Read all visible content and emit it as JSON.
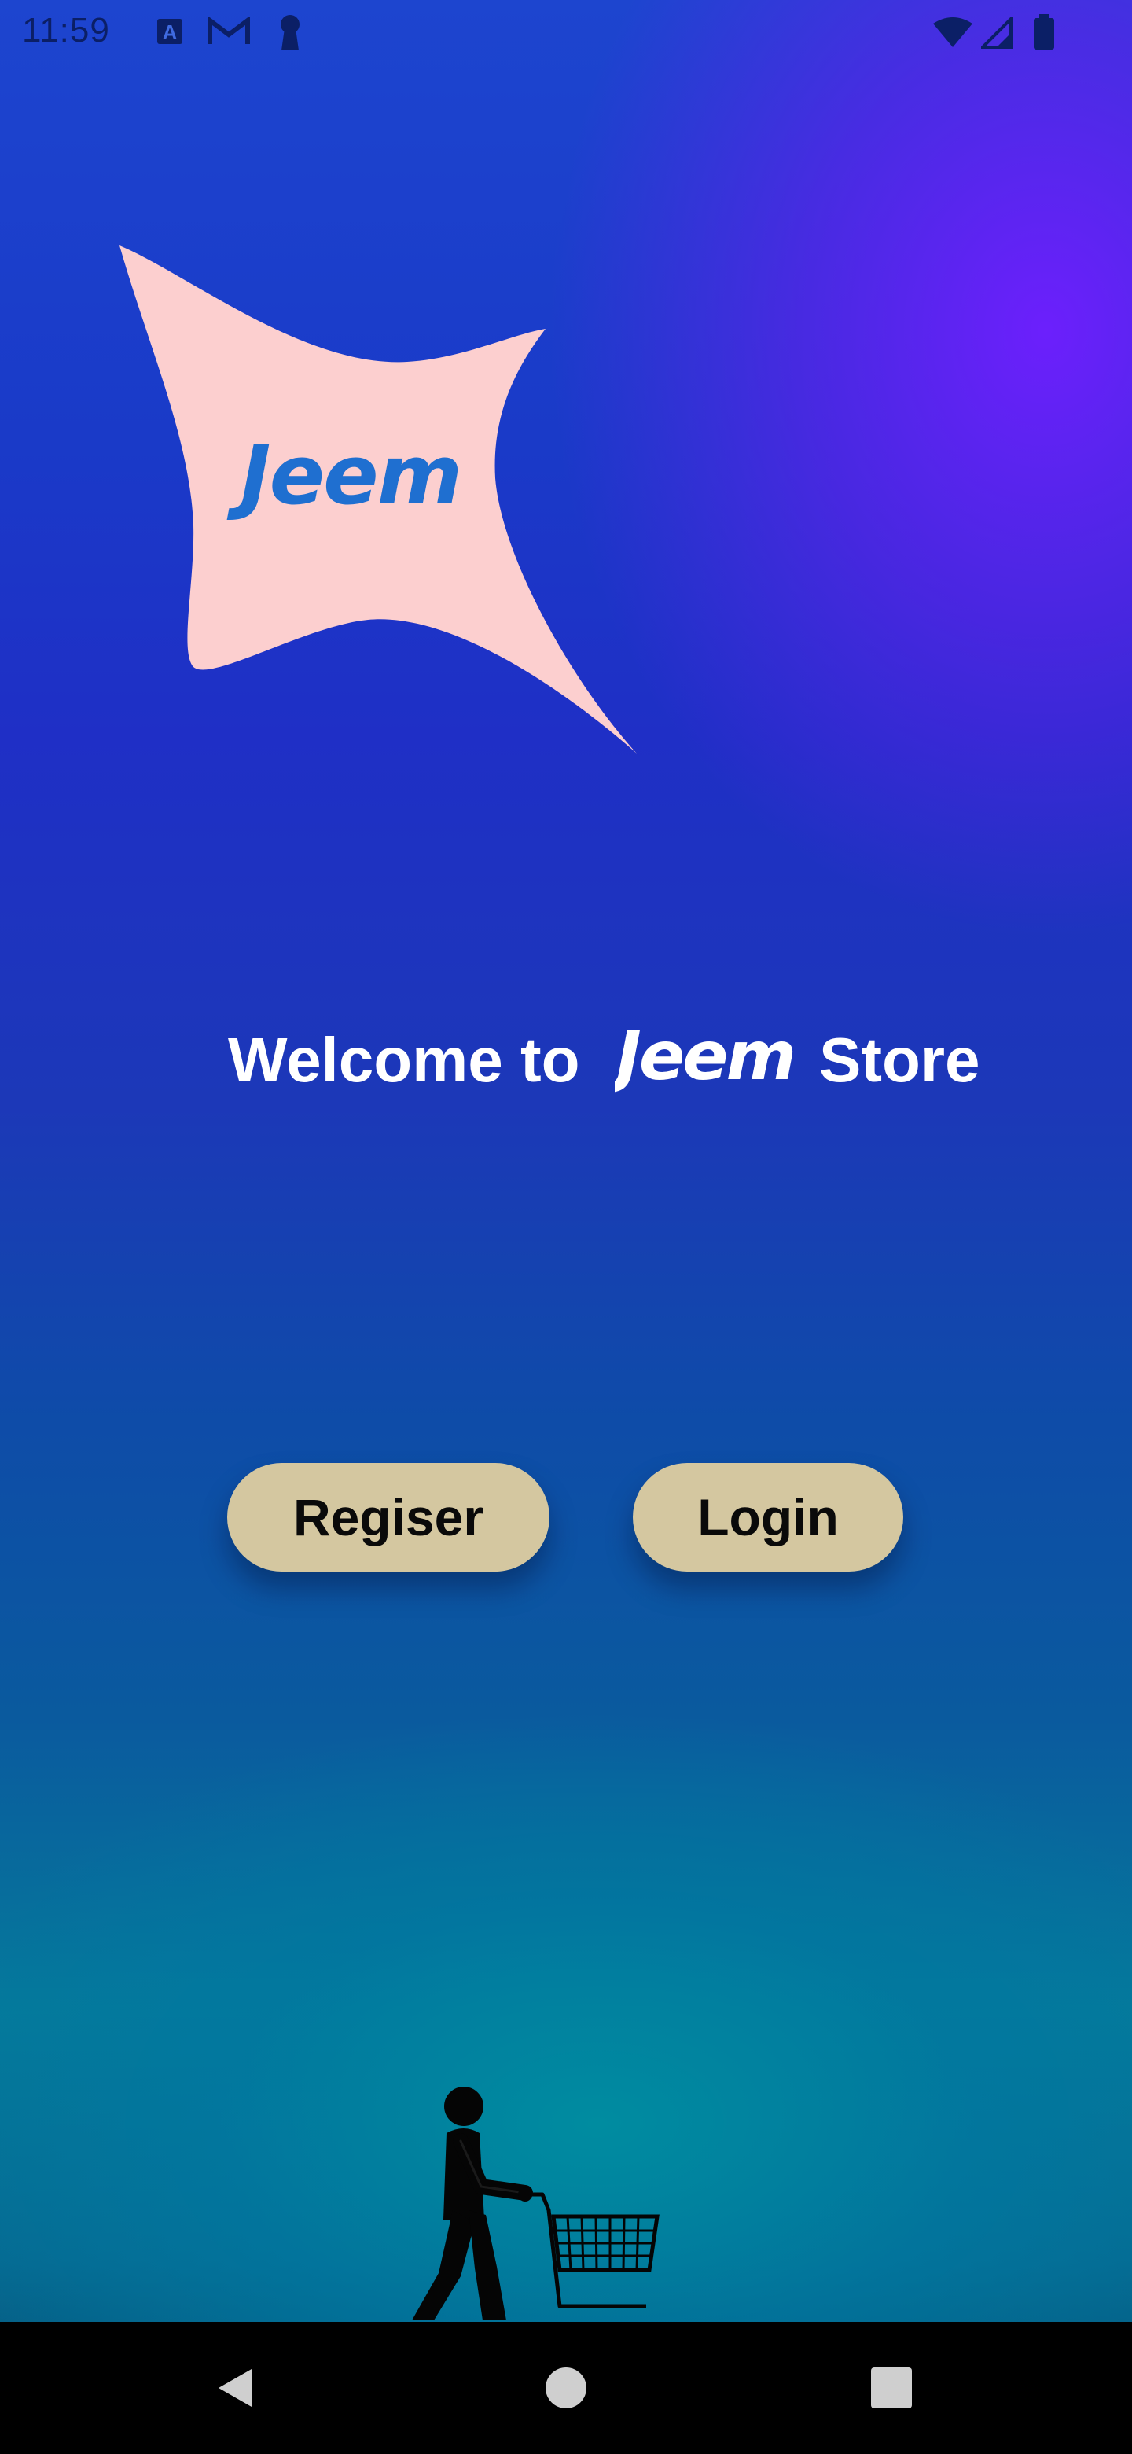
{
  "status_bar": {
    "time": "11:59",
    "icons": [
      "a-box-icon",
      "gmail-icon",
      "keyhole-icon",
      "wifi-icon",
      "signal-icon",
      "battery-icon"
    ],
    "icon_color": "#0b1f66"
  },
  "logo": {
    "wordmark": "Jeem",
    "shape_color": "#fccfcf",
    "text_color": "#1f6fd0"
  },
  "welcome": {
    "prefix": "Welcome to",
    "brand": "Jeem",
    "suffix": "Store"
  },
  "buttons": {
    "register_label": "Regiser",
    "login_label": "Login",
    "color": "#d4c7a0"
  },
  "illustration": {
    "icon": "shopper-with-cart-icon"
  },
  "nav_bar": {
    "icons": [
      "back-icon",
      "home-icon",
      "recents-icon"
    ],
    "icon_color": "#cfcfcf"
  },
  "colors": {
    "gradient_top": "#1d45cf",
    "gradient_purple": "#701eff",
    "gradient_bottom": "#057a9b"
  }
}
